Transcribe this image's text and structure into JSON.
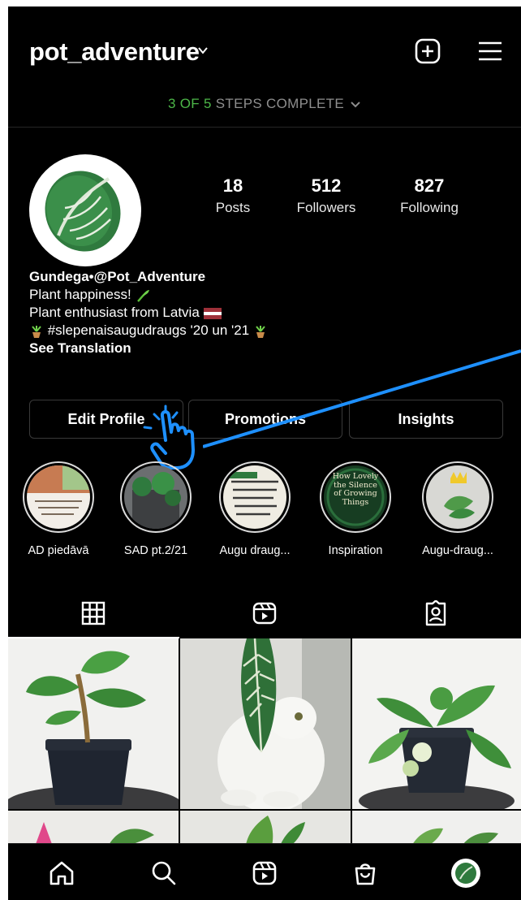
{
  "header": {
    "username": "pot_adventure",
    "icons": [
      "chevron-down-icon",
      "new-post-icon",
      "menu-icon"
    ]
  },
  "steps": {
    "done": "3 OF 5",
    "rest": " STEPS COMPLETE"
  },
  "stats": [
    {
      "value": "18",
      "label": "Posts"
    },
    {
      "value": "512",
      "label": "Followers"
    },
    {
      "value": "827",
      "label": "Following"
    }
  ],
  "bio": {
    "name": "Gundega•@Pot_Adventure",
    "line1": "Plant happiness! ",
    "line2": "Plant enthusiast from Latvia ",
    "line3": " #slepenaisaugudraugs  '20 un '21 ",
    "translate": "See Translation"
  },
  "buttons": {
    "edit": "Edit Profile",
    "promotions": "Promotions",
    "insights": "Insights"
  },
  "highlights": [
    {
      "label": "AD piedāvā"
    },
    {
      "label": "SAD pt.2/21"
    },
    {
      "label": "Augu draug..."
    },
    {
      "label": "Inspiration",
      "text": "How Lovely the Silence of Growing Things"
    },
    {
      "label": "Augu-draug..."
    }
  ],
  "tabs": [
    "grid-icon",
    "reels-icon",
    "tagged-icon"
  ],
  "nav": [
    "home-icon",
    "search-icon",
    "reels-icon",
    "shop-icon",
    "profile-avatar"
  ],
  "colors": {
    "background": "#000000",
    "accent_green": "#4cb648",
    "annotation_blue": "#1e90ff"
  }
}
